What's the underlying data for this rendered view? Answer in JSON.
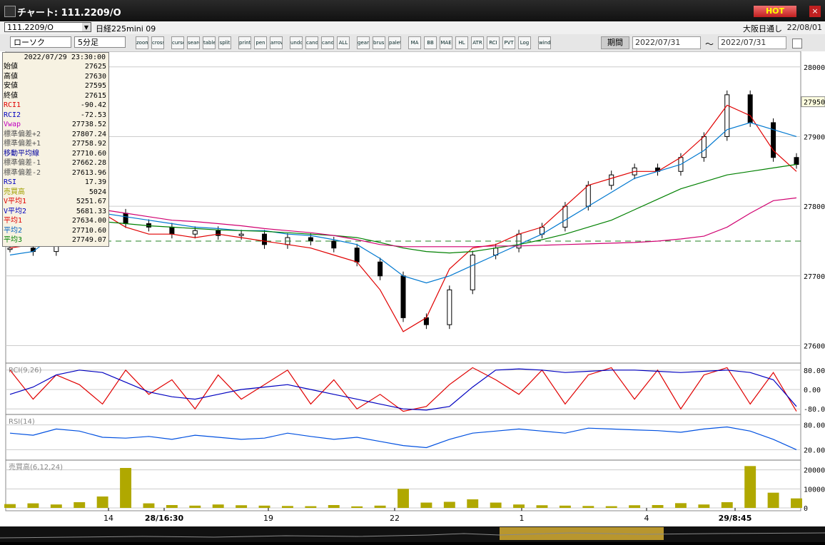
{
  "window": {
    "title": "チャート: 111.2209/O",
    "hot_label": "HOT",
    "close_label": "×"
  },
  "subbar": {
    "code": "111.2209/O",
    "issue_name": "日経225mini 09",
    "session": "大阪日通し",
    "date": "22/08/01"
  },
  "toolbar": {
    "chart_type": "ローソク",
    "interval": "5分足",
    "buttons": [
      "zoom",
      "crosshair",
      "cursor",
      "search",
      "table",
      "split",
      "print",
      "pen",
      "arrow",
      "undo",
      "candle1",
      "candle2",
      "ALL",
      "gear",
      "brush",
      "palette",
      "MA",
      "BB",
      "MAE",
      "HL",
      "ATR",
      "RCI",
      "PVT",
      "Log",
      "window"
    ],
    "period_label": "期間",
    "date_from": "2022/07/31",
    "date_to": "2022/07/31",
    "tilde": "〜"
  },
  "info": {
    "datetime": "2022/07/29 23:30:00",
    "rows": [
      {
        "label": "始値",
        "value": "27625",
        "color": "#000"
      },
      {
        "label": "高値",
        "value": "27630",
        "color": "#000"
      },
      {
        "label": "安値",
        "value": "27595",
        "color": "#000"
      },
      {
        "label": "終値",
        "value": "27615",
        "color": "#000"
      },
      {
        "label": "RCI1",
        "value": "-90.42",
        "color": "#e00000"
      },
      {
        "label": "RCI2",
        "value": "-72.53",
        "color": "#0000c0"
      },
      {
        "label": "Vwap",
        "value": "27738.52",
        "color": "#c000c0"
      },
      {
        "label": "標準偏差+2",
        "value": "27807.24",
        "color": "#555"
      },
      {
        "label": "標準偏差+1",
        "value": "27758.92",
        "color": "#555"
      },
      {
        "label": "移動平均線",
        "value": "27710.60",
        "color": "#0000a0"
      },
      {
        "label": "標準偏差-1",
        "value": "27662.28",
        "color": "#555"
      },
      {
        "label": "標準偏差-2",
        "value": "27613.96",
        "color": "#555"
      },
      {
        "label": "RSI",
        "value": "17.39",
        "color": "#0000c0"
      },
      {
        "label": "売買高",
        "value": "5024",
        "color": "#a0a000"
      },
      {
        "label": "V平均1",
        "value": "5251.67",
        "color": "#e00000"
      },
      {
        "label": "V平均2",
        "value": "5681.33",
        "color": "#0000c0"
      },
      {
        "label": "平均1",
        "value": "27634.00",
        "color": "#e00000"
      },
      {
        "label": "平均2",
        "value": "27710.60",
        "color": "#0060c0"
      },
      {
        "label": "平均3",
        "value": "27749.07",
        "color": "#008000"
      }
    ]
  },
  "chart_data": [
    {
      "type": "line",
      "title": "",
      "y_ticks": [
        "28000",
        "27900",
        "27800",
        "27700",
        "27600"
      ],
      "last_price_label": "27950",
      "x_ticks": [
        "14",
        "28/16:30",
        "19",
        "22",
        "1",
        "4",
        "29/8:45"
      ],
      "ylim": [
        27580,
        28010
      ],
      "series": [
        {
          "name": "平均1",
          "values": [
            27740,
            27745,
            27800,
            27810,
            27790,
            27770,
            27760,
            27760,
            27755,
            27760,
            27755,
            27750,
            27745,
            27740,
            27730,
            27720,
            27680,
            27620,
            27640,
            27710,
            27740,
            27745,
            27760,
            27770,
            27800,
            27830,
            27840,
            27850,
            27850,
            27870,
            27900,
            27945,
            27930,
            27880,
            27850
          ]
        },
        {
          "name": "平均2",
          "values": [
            27730,
            27735,
            27760,
            27780,
            27790,
            27785,
            27780,
            27775,
            27770,
            27768,
            27765,
            27765,
            27760,
            27758,
            27752,
            27745,
            27725,
            27700,
            27690,
            27700,
            27715,
            27730,
            27745,
            27760,
            27780,
            27800,
            27820,
            27840,
            27850,
            27860,
            27880,
            27910,
            27920,
            27910,
            27900
          ]
        },
        {
          "name": "平均3",
          "values": [
            27790,
            27788,
            27785,
            27782,
            27778,
            27775,
            27772,
            27770,
            27768,
            27766,
            27765,
            27764,
            27762,
            27760,
            27758,
            27755,
            27748,
            27740,
            27735,
            27733,
            27735,
            27740,
            27745,
            27752,
            27760,
            27770,
            27780,
            27795,
            27810,
            27825,
            27835,
            27845,
            27850,
            27855,
            27860
          ]
        },
        {
          "name": "Vwap",
          "values": [
            27810,
            27808,
            27805,
            27800,
            27795,
            27790,
            27785,
            27780,
            27778,
            27775,
            27772,
            27768,
            27765,
            27762,
            27758,
            27752,
            27745,
            27742,
            27742,
            27742,
            27742,
            27743,
            27743,
            27744,
            27745,
            27746,
            27747,
            27748,
            27750,
            27753,
            27757,
            27770,
            27790,
            27808,
            27812
          ]
        }
      ],
      "reference_line": 27750,
      "closes": [
        27740,
        27735,
        27780,
        27810,
        27790,
        27775,
        27770,
        27760,
        27765,
        27758,
        27760,
        27745,
        27755,
        27750,
        27740,
        27720,
        27700,
        27640,
        27630,
        27680,
        27730,
        27740,
        27760,
        27770,
        27800,
        27830,
        27845,
        27855,
        27850,
        27870,
        27900,
        27960,
        27920,
        27870,
        27860
      ]
    },
    {
      "type": "line",
      "title": "RCI(9,26)",
      "y_ticks": [
        "80.00",
        "0.00",
        "-80.0"
      ],
      "ylim": [
        -100,
        100
      ],
      "series": [
        {
          "name": "RCI1",
          "values": [
            80,
            -40,
            60,
            20,
            -60,
            80,
            -20,
            40,
            -80,
            60,
            -40,
            20,
            80,
            -60,
            40,
            -80,
            -20,
            -90,
            -70,
            20,
            90,
            40,
            -20,
            80,
            -60,
            60,
            90,
            -40,
            80,
            -80,
            60,
            90,
            -60,
            70,
            -90
          ]
        },
        {
          "name": "RCI2",
          "values": [
            -20,
            10,
            60,
            80,
            70,
            30,
            -10,
            -30,
            -40,
            -20,
            0,
            10,
            20,
            0,
            -20,
            -40,
            -60,
            -80,
            -85,
            -70,
            10,
            80,
            85,
            80,
            70,
            75,
            80,
            80,
            75,
            70,
            75,
            80,
            70,
            40,
            -70
          ]
        }
      ]
    },
    {
      "type": "line",
      "title": "RSI(14)",
      "y_ticks": [
        "80.00",
        "20.00"
      ],
      "ylim": [
        0,
        100
      ],
      "series": [
        {
          "name": "RSI",
          "values": [
            60,
            55,
            70,
            65,
            50,
            48,
            52,
            45,
            55,
            50,
            45,
            48,
            60,
            52,
            45,
            50,
            40,
            30,
            25,
            45,
            60,
            65,
            70,
            65,
            60,
            72,
            70,
            68,
            66,
            62,
            70,
            75,
            65,
            45,
            20
          ]
        }
      ]
    },
    {
      "type": "bar",
      "title": "売買高(6,12,24)",
      "y_ticks": [
        "20000",
        "10000",
        "0"
      ],
      "ylim": [
        0,
        24000
      ],
      "values": [
        2000,
        2400,
        1800,
        3000,
        6000,
        21000,
        2400,
        1500,
        1200,
        1800,
        1400,
        1200,
        1000,
        900,
        1500,
        800,
        1200,
        10000,
        2800,
        3200,
        4500,
        2800,
        1800,
        1400,
        1200,
        1000,
        900,
        1400,
        1500,
        2500,
        1800,
        3000,
        22000,
        8000,
        5000
      ]
    }
  ]
}
